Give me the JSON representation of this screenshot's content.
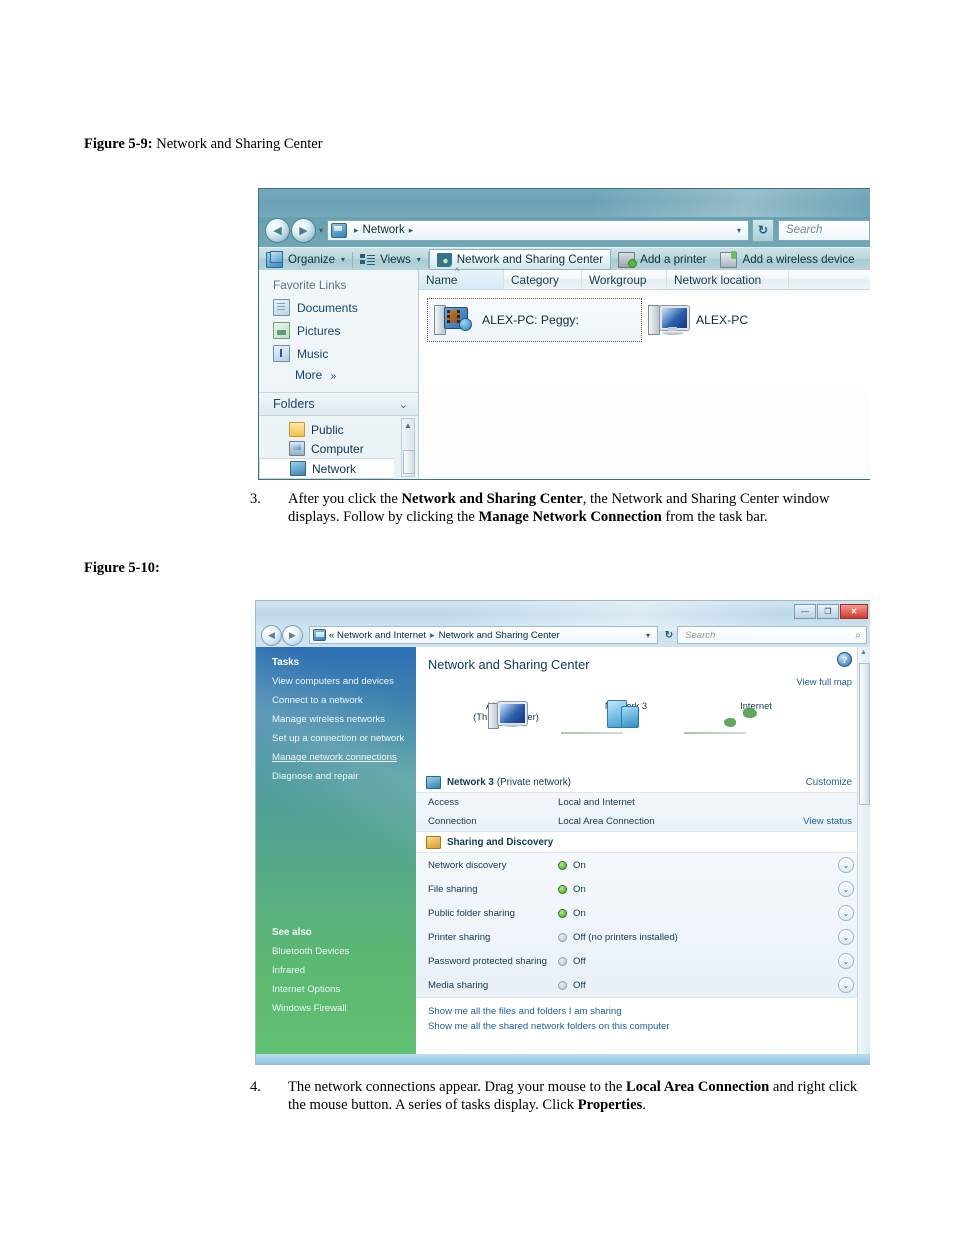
{
  "document": {
    "figure1": {
      "label": "Figure 5-9:",
      "caption": "Network and Sharing Center"
    },
    "figure2": {
      "label": "Figure 5-10:",
      "caption": ""
    },
    "step3": {
      "number": "3.",
      "part1": "After you click the ",
      "bold1": "Network and Sharing Center",
      "part2": ", the Network and Sharing Center window displays. Follow by clicking the ",
      "bold2": "Manage Network Connection",
      "part3": " from the task bar."
    },
    "step4": {
      "number": "4.",
      "part1": "The network connections appear. Drag your mouse to the ",
      "bold1": "Local Area Connection",
      "part2": " and right click the mouse button. A series of tasks display. Click ",
      "bold2": "Properties",
      "part3": "."
    }
  },
  "window1": {
    "nav": {
      "back_icon": "back-arrow-icon",
      "forward_icon": "forward-arrow-icon",
      "history_caret": "▾",
      "breadcrumb_icon": "network-icon",
      "breadcrumb_sep1": "▸",
      "breadcrumb_text": "Network",
      "breadcrumb_sep2": "▸",
      "address_dropdown": "▾",
      "refresh_icon": "refresh-icon",
      "search_placeholder": "Search"
    },
    "toolbar": {
      "organize": "Organize",
      "organize_caret": "▾",
      "views": "Views",
      "views_caret": "▾",
      "network_sharing_center": "Network and Sharing Center",
      "add_printer": "Add a printer",
      "add_wireless_device": "Add a wireless device"
    },
    "navpane": {
      "favorites_title": "Favorite Links",
      "favorites": [
        {
          "label": "Documents",
          "icon": "documents-icon"
        },
        {
          "label": "Pictures",
          "icon": "pictures-icon"
        },
        {
          "label": "Music",
          "icon": "music-icon"
        }
      ],
      "more_label": "More",
      "more_chevron": "»",
      "folders_title": "Folders",
      "folders_chevron": "⌄",
      "tree": [
        {
          "label": "Public",
          "icon": "folder-icon",
          "selected": false
        },
        {
          "label": "Computer",
          "icon": "computer-icon",
          "selected": false
        },
        {
          "label": "Network",
          "icon": "network-icon",
          "selected": true
        }
      ]
    },
    "columns": [
      "Name",
      "Category",
      "Workgroup",
      "Network location"
    ],
    "items": [
      {
        "label": "ALEX-PC: Peggy:",
        "icon": "media-device-icon",
        "selected": true
      },
      {
        "label": "ALEX-PC",
        "icon": "computer-icon",
        "selected": false
      }
    ]
  },
  "window2": {
    "titlebar": {
      "minimize": "—",
      "maximize": "❐",
      "close": "✕"
    },
    "nav": {
      "back_icon": "back-arrow-icon",
      "forward_icon": "forward-arrow-icon",
      "breadcrumb_icon": "network-icon",
      "breadcrumb_prefix": "«",
      "breadcrumb_1": "Network and Internet",
      "breadcrumb_sep": "▸",
      "breadcrumb_2": "Network and Sharing Center",
      "address_dropdown": "▾",
      "refresh_icon": "refresh-icon",
      "search_placeholder": "Search",
      "search_icon": "magnifier-icon"
    },
    "taskpane": {
      "tasks_title": "Tasks",
      "tasks": [
        "View computers and devices",
        "Connect to a network",
        "Manage wireless networks",
        "Set up a connection or network",
        "Manage network connections",
        "Diagnose and repair"
      ],
      "active_task": "Manage network connections",
      "see_also_title": "See also",
      "see_also": [
        "Bluetooth Devices",
        "Infrared",
        "Internet Options",
        "Windows Firewall"
      ]
    },
    "content": {
      "help_icon": "help-icon",
      "heading": "Network and Sharing Center",
      "view_full_map": "View full map",
      "map_nodes": [
        {
          "name": "ALEX-PC",
          "sub": "(This computer)",
          "icon": "computer-icon"
        },
        {
          "name": "Network 3",
          "sub": "",
          "icon": "network-cube-icon"
        },
        {
          "name": "Internet",
          "sub": "",
          "icon": "globe-icon"
        }
      ],
      "network_section": {
        "icon": "network-icon",
        "name": "Network 3",
        "type": "(Private network)",
        "customize": "Customize",
        "rows": [
          {
            "label": "Access",
            "value": "Local and Internet",
            "action": ""
          },
          {
            "label": "Connection",
            "value": "Local Area Connection",
            "action": "View status"
          }
        ]
      },
      "sharing_section": {
        "icon": "sharing-icon",
        "title": "Sharing and Discovery",
        "rows": [
          {
            "label": "Network discovery",
            "state": "on",
            "status": "On",
            "expand": "⌄"
          },
          {
            "label": "File sharing",
            "state": "on",
            "status": "On",
            "expand": "⌄"
          },
          {
            "label": "Public folder sharing",
            "state": "on",
            "status": "On",
            "expand": "⌄"
          },
          {
            "label": "Printer sharing",
            "state": "off",
            "status": "Off (no printers installed)",
            "expand": "⌄"
          },
          {
            "label": "Password protected sharing",
            "state": "off",
            "status": "Off",
            "expand": "⌄"
          },
          {
            "label": "Media sharing",
            "state": "off",
            "status": "Off",
            "expand": "⌄"
          }
        ]
      },
      "bottom_links": [
        "Show me all the files and folders I am sharing",
        "Show me all the shared network folders on this computer"
      ]
    }
  },
  "colors": {
    "window1_chrome": "#6ba2b5",
    "window2_taskpane_top": "#2f6fb4",
    "window2_taskpane_bottom": "#62c272",
    "link_blue": "#1d5f99",
    "status_on_green": "#3f9c23",
    "status_off_gray": "#b4c2cb",
    "close_button_red": "#cf3b2c"
  }
}
